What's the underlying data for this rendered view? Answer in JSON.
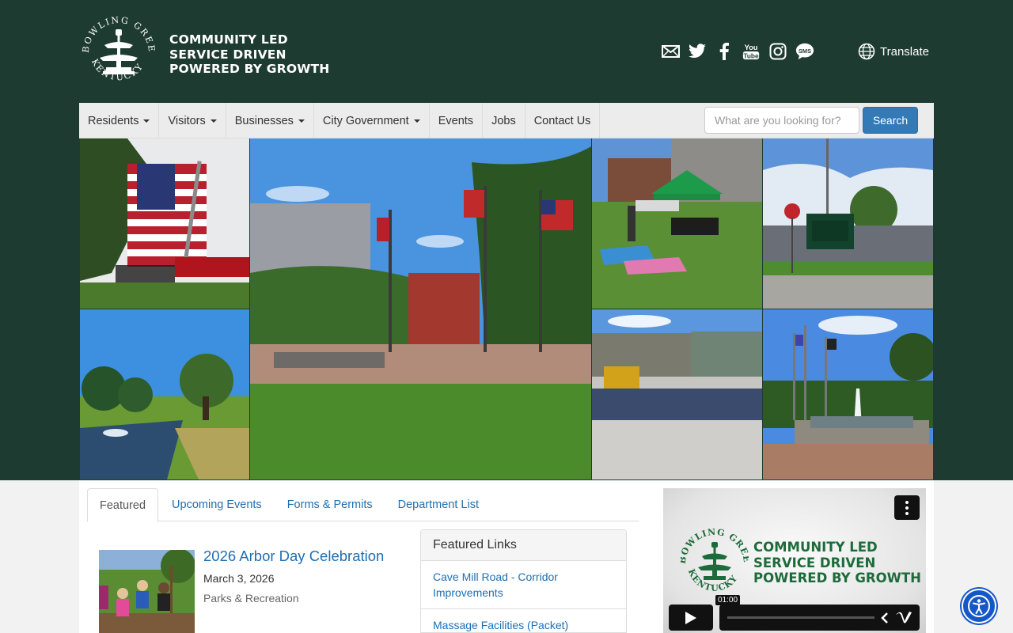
{
  "header": {
    "logo_alt": "Bowling Green Kentucky",
    "tagline": [
      "COMMUNITY LED",
      "SERVICE DRIVEN",
      "POWERED BY GROWTH"
    ],
    "social_icons": [
      "email-icon",
      "twitter-icon",
      "facebook-icon",
      "youtube-icon",
      "instagram-icon",
      "sms-icon"
    ],
    "translate_label": "Translate"
  },
  "nav": {
    "items": [
      {
        "label": "Residents",
        "dropdown": true
      },
      {
        "label": "Visitors",
        "dropdown": true
      },
      {
        "label": "Businesses",
        "dropdown": true
      },
      {
        "label": "City Government",
        "dropdown": true
      },
      {
        "label": "Events",
        "dropdown": false
      },
      {
        "label": "Jobs",
        "dropdown": false
      },
      {
        "label": "Contact Us",
        "dropdown": false
      }
    ],
    "search_placeholder": "What are you looking for?",
    "search_button": "Search"
  },
  "tabs": [
    {
      "label": "Featured",
      "active": true
    },
    {
      "label": "Upcoming Events",
      "active": false
    },
    {
      "label": "Forms & Permits",
      "active": false
    },
    {
      "label": "Department List",
      "active": false
    }
  ],
  "featured_event": {
    "title": "2026 Arbor Day Celebration",
    "date": "March 3, 2026",
    "department": "Parks & Recreation"
  },
  "featured_links": {
    "heading": "Featured Links",
    "links": [
      "Cave Mill Road - Corridor Improvements",
      "Massage Facilities (Packet)"
    ]
  },
  "video": {
    "tagline": [
      "COMMUNITY LED",
      "SERVICE DRIVEN",
      "POWERED BY GROWTH"
    ],
    "time": "01:00"
  },
  "colors": {
    "header_bg": "#1e3b32",
    "link": "#1f6fb2",
    "search_button": "#337ab7",
    "accessibility_button": "#1458c8"
  }
}
